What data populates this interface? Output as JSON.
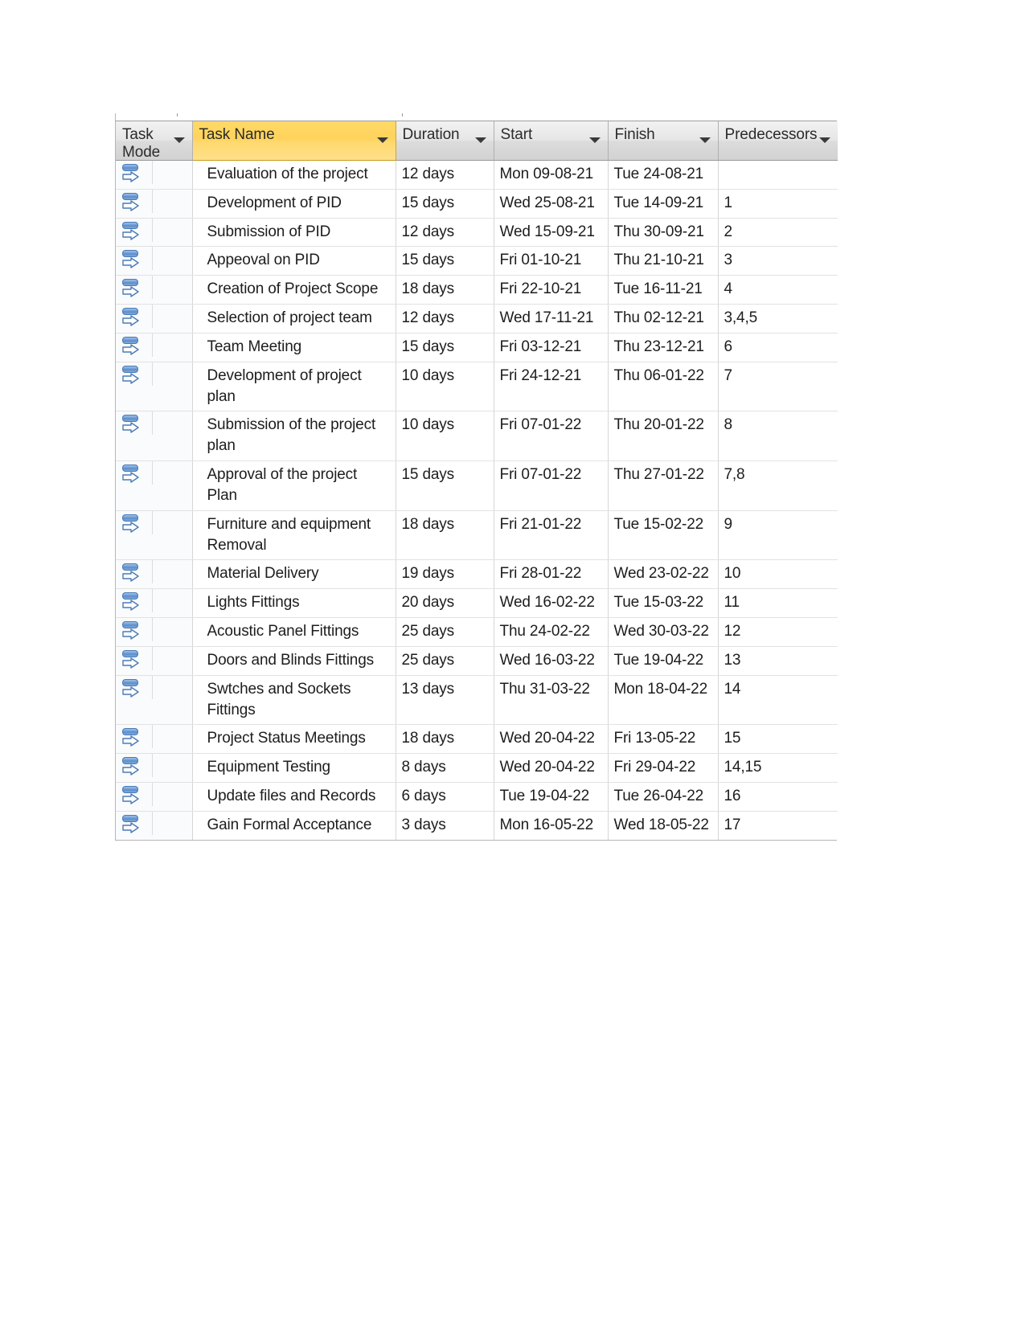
{
  "table": {
    "columns": [
      {
        "key": "task_mode",
        "label": "Task\nMode",
        "selected": false
      },
      {
        "key": "task_name",
        "label": "Task Name",
        "selected": true
      },
      {
        "key": "duration",
        "label": "Duration",
        "selected": false
      },
      {
        "key": "start",
        "label": "Start",
        "selected": false
      },
      {
        "key": "finish",
        "label": "Finish",
        "selected": false
      },
      {
        "key": "predecessors",
        "label": "Predecessors",
        "selected": false
      }
    ],
    "column_labels": {
      "task_mode_line1": "Task",
      "task_mode_line2": "Mode",
      "task_name": "Task Name",
      "duration": "Duration",
      "start": "Start",
      "finish": "Finish",
      "predecessors": "Predecessors"
    },
    "mode_icon": "auto-schedule-icon",
    "filter_icon": "chevron-down-icon",
    "rows": [
      {
        "mode": "auto-schedule-icon",
        "name": "Evaluation of the project",
        "duration": "12 days",
        "start": "Mon 09-08-21",
        "finish": "Tue 24-08-21",
        "predecessors": ""
      },
      {
        "mode": "auto-schedule-icon",
        "name": "Development of PID",
        "duration": "15 days",
        "start": "Wed 25-08-21",
        "finish": "Tue 14-09-21",
        "predecessors": "1"
      },
      {
        "mode": "auto-schedule-icon",
        "name": "Submission of PID",
        "duration": "12 days",
        "start": "Wed 15-09-21",
        "finish": "Thu 30-09-21",
        "predecessors": "2"
      },
      {
        "mode": "auto-schedule-icon",
        "name": "Appeoval on PID",
        "duration": "15 days",
        "start": "Fri 01-10-21",
        "finish": "Thu 21-10-21",
        "predecessors": "3"
      },
      {
        "mode": "auto-schedule-icon",
        "name": "Creation of Project Scope",
        "duration": "18 days",
        "start": "Fri 22-10-21",
        "finish": "Tue 16-11-21",
        "predecessors": "4"
      },
      {
        "mode": "auto-schedule-icon",
        "name": "Selection of project team",
        "duration": "12 days",
        "start": "Wed 17-11-21",
        "finish": "Thu 02-12-21",
        "predecessors": "3,4,5"
      },
      {
        "mode": "auto-schedule-icon",
        "name": "Team Meeting",
        "duration": "15 days",
        "start": "Fri 03-12-21",
        "finish": "Thu 23-12-21",
        "predecessors": "6"
      },
      {
        "mode": "auto-schedule-icon",
        "name": "Development of project plan",
        "duration": "10 days",
        "start": "Fri 24-12-21",
        "finish": "Thu 06-01-22",
        "predecessors": "7"
      },
      {
        "mode": "auto-schedule-icon",
        "name": "Submission of the project plan",
        "duration": "10 days",
        "start": "Fri 07-01-22",
        "finish": "Thu 20-01-22",
        "predecessors": "8"
      },
      {
        "mode": "auto-schedule-icon",
        "name": "Approval of the project Plan",
        "duration": "15 days",
        "start": "Fri 07-01-22",
        "finish": "Thu 27-01-22",
        "predecessors": "7,8"
      },
      {
        "mode": "auto-schedule-icon",
        "name": "Furniture and equipment Removal",
        "duration": "18 days",
        "start": "Fri 21-01-22",
        "finish": "Tue 15-02-22",
        "predecessors": "9"
      },
      {
        "mode": "auto-schedule-icon",
        "name": "Material Delivery",
        "duration": "19 days",
        "start": "Fri 28-01-22",
        "finish": "Wed 23-02-22",
        "predecessors": "10"
      },
      {
        "mode": "auto-schedule-icon",
        "name": "Lights Fittings",
        "duration": "20 days",
        "start": "Wed 16-02-22",
        "finish": "Tue 15-03-22",
        "predecessors": "11"
      },
      {
        "mode": "auto-schedule-icon",
        "name": "Acoustic Panel Fittings",
        "duration": "25 days",
        "start": "Thu 24-02-22",
        "finish": "Wed 30-03-22",
        "predecessors": "12"
      },
      {
        "mode": "auto-schedule-icon",
        "name": "Doors and Blinds Fittings",
        "duration": "25 days",
        "start": "Wed 16-03-22",
        "finish": "Tue 19-04-22",
        "predecessors": "13"
      },
      {
        "mode": "auto-schedule-icon",
        "name": "Swtches and Sockets Fittings",
        "duration": "13 days",
        "start": "Thu 31-03-22",
        "finish": "Mon 18-04-22",
        "predecessors": "14"
      },
      {
        "mode": "auto-schedule-icon",
        "name": "Project Status Meetings",
        "duration": "18 days",
        "start": "Wed 20-04-22",
        "finish": "Fri 13-05-22",
        "predecessors": "15"
      },
      {
        "mode": "auto-schedule-icon",
        "name": "Equipment Testing",
        "duration": "8 days",
        "start": "Wed 20-04-22",
        "finish": "Fri 29-04-22",
        "predecessors": "14,15"
      },
      {
        "mode": "auto-schedule-icon",
        "name": "Update files and Records",
        "duration": "6 days",
        "start": "Tue 19-04-22",
        "finish": "Tue 26-04-22",
        "predecessors": "16"
      },
      {
        "mode": "auto-schedule-icon",
        "name": "Gain Formal Acceptance",
        "duration": "3 days",
        "start": "Mon 16-05-22",
        "finish": "Wed 18-05-22",
        "predecessors": "17"
      }
    ]
  },
  "colors": {
    "header_gray": "#dcdcdc",
    "header_selected_gold": "#ffd966",
    "icon_blue": "#6d9bd4",
    "grid_border": "#b5b5b5",
    "cell_border": "#e2e2e2",
    "text": "#1d1d1d"
  }
}
